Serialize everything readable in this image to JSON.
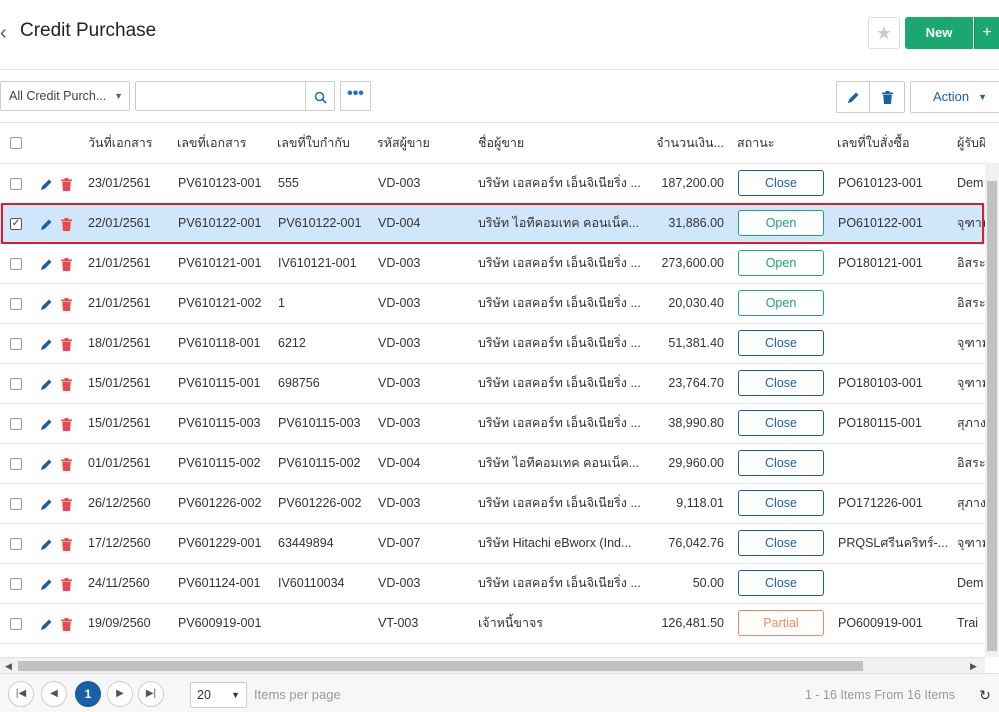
{
  "header": {
    "back_icon": "chevron-left-icon",
    "title": "Credit Purchase",
    "new_label": "New",
    "plus_label": "+"
  },
  "toolbar": {
    "filter_value": "All Credit Purch...",
    "search_value": "",
    "action_label": "Action"
  },
  "table": {
    "columns": [
      "วันที่เอกสาร",
      "เลขที่เอกสาร",
      "เลขที่ใบกำกับ",
      "รหัสผู้ขาย",
      "ชื่อผู้ขาย",
      "จำนวนเงิน...",
      "สถานะ",
      "เลขที่ใบสั่งซื้อ",
      "ผู้รับผิ"
    ],
    "rows": [
      {
        "date": "23/01/2561",
        "doc": "PV610123-001",
        "inv": "555",
        "vcode": "VD-003",
        "vname": "บริษัท เอสคอร์ท เอ็นจิเนียริ่ง ...",
        "amount": "187,200.00",
        "status": "Close",
        "po": "PO610123-001",
        "owner": "Dem",
        "checked": false
      },
      {
        "date": "22/01/2561",
        "doc": "PV610122-001",
        "inv": "PV610122-001",
        "vcode": "VD-004",
        "vname": "บริษัท ไอทีคอมเทค คอนเน็ค...",
        "amount": "31,886.00",
        "status": "Open",
        "po": "PO610122-001",
        "owner": "จุฑาม",
        "checked": true
      },
      {
        "date": "21/01/2561",
        "doc": "PV610121-001",
        "inv": "IV610121-001",
        "vcode": "VD-003",
        "vname": "บริษัท เอสคอร์ท เอ็นจิเนียริ่ง ...",
        "amount": "273,600.00",
        "status": "Open",
        "po": "PO180121-001",
        "owner": "อิสระ",
        "checked": false
      },
      {
        "date": "21/01/2561",
        "doc": "PV610121-002",
        "inv": "1",
        "vcode": "VD-003",
        "vname": "บริษัท เอสคอร์ท เอ็นจิเนียริ่ง ...",
        "amount": "20,030.40",
        "status": "Open",
        "po": "",
        "owner": "อิสระ",
        "checked": false
      },
      {
        "date": "18/01/2561",
        "doc": "PV610118-001",
        "inv": "6212",
        "vcode": "VD-003",
        "vname": "บริษัท เอสคอร์ท เอ็นจิเนียริ่ง ...",
        "amount": "51,381.40",
        "status": "Close",
        "po": "",
        "owner": "จุฑาม",
        "checked": false
      },
      {
        "date": "15/01/2561",
        "doc": "PV610115-001",
        "inv": "698756",
        "vcode": "VD-003",
        "vname": "บริษัท เอสคอร์ท เอ็นจิเนียริ่ง ...",
        "amount": "23,764.70",
        "status": "Close",
        "po": "PO180103-001",
        "owner": "จุฑาม",
        "checked": false
      },
      {
        "date": "15/01/2561",
        "doc": "PV610115-003",
        "inv": "PV610115-003",
        "vcode": "VD-003",
        "vname": "บริษัท เอสคอร์ท เอ็นจิเนียริ่ง ...",
        "amount": "38,990.80",
        "status": "Close",
        "po": "PO180115-001",
        "owner": "สุภาง",
        "checked": false
      },
      {
        "date": "01/01/2561",
        "doc": "PV610115-002",
        "inv": "PV610115-002",
        "vcode": "VD-004",
        "vname": "บริษัท ไอทีคอมเทค คอนเน็ค...",
        "amount": "29,960.00",
        "status": "Close",
        "po": "",
        "owner": "อิสระ",
        "checked": false
      },
      {
        "date": "26/12/2560",
        "doc": "PV601226-002",
        "inv": "PV601226-002",
        "vcode": "VD-003",
        "vname": "บริษัท เอสคอร์ท เอ็นจิเนียริ่ง ...",
        "amount": "9,118.01",
        "status": "Close",
        "po": "PO171226-001",
        "owner": "สุภาง",
        "checked": false
      },
      {
        "date": "17/12/2560",
        "doc": "PV601229-001",
        "inv": "63449894",
        "vcode": "VD-007",
        "vname": "บริษัท Hitachi eBworx (Ind...",
        "amount": "76,042.76",
        "status": "Close",
        "po": "PRQSLศรีนคริทร์-...",
        "owner": "จุฑาม",
        "checked": false
      },
      {
        "date": "24/11/2560",
        "doc": "PV601124-001",
        "inv": "IV60110034",
        "vcode": "VD-003",
        "vname": "บริษัท เอสคอร์ท เอ็นจิเนียริ่ง ...",
        "amount": "50.00",
        "status": "Close",
        "po": "",
        "owner": "Dem",
        "checked": false
      },
      {
        "date": "19/09/2560",
        "doc": "PV600919-001",
        "inv": "",
        "vcode": "VT-003",
        "vname": "เจ้าหนี้ขาจร",
        "amount": "126,481.50",
        "status": "Partial",
        "po": "PO600919-001",
        "owner": "Trai",
        "checked": false
      }
    ]
  },
  "pager": {
    "current_page": "1",
    "page_size": "20",
    "items_per_page_label": "Items per page",
    "info": "1 - 16 Items From 16 Items"
  }
}
